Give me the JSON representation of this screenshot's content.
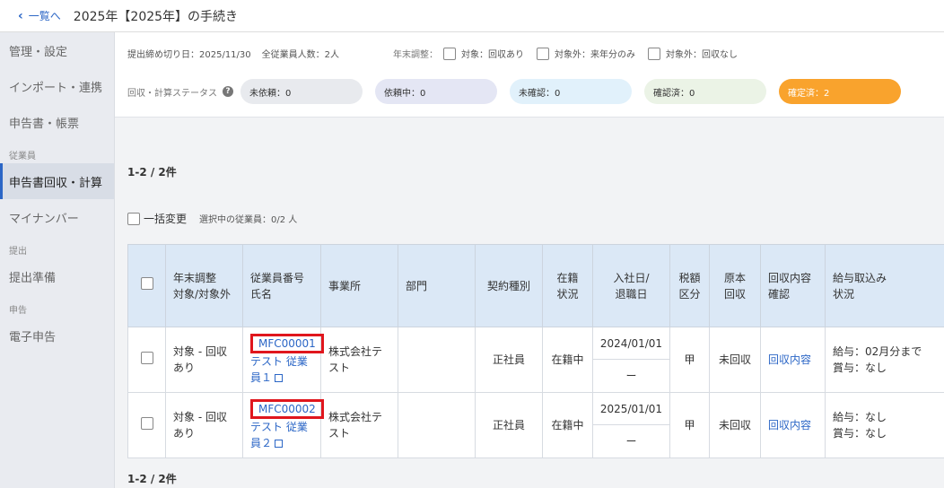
{
  "header": {
    "back_label": "一覧へ",
    "title": "2025年【2025年】の手続き"
  },
  "sidebar": {
    "items": [
      {
        "label": "管理・設定"
      },
      {
        "label": "インポート・連携"
      },
      {
        "label": "申告書・帳票"
      }
    ],
    "section_employee": "従業員",
    "employee_items": [
      {
        "label": "申告書回収・計算"
      },
      {
        "label": "マイナンバー"
      }
    ],
    "section_submit": "提出",
    "submit_items": [
      {
        "label": "提出準備"
      }
    ],
    "section_report": "申告",
    "report_items": [
      {
        "label": "電子申告"
      }
    ]
  },
  "filters": {
    "deadline": "提出締め切り日：2025/11/30",
    "employee_count": "全従業員人数：2人",
    "year_end_label": "年末調整：",
    "options": [
      "対象：回収あり",
      "対象外：来年分のみ",
      "対象外：回収なし"
    ],
    "status_label": "回収・計算ステータス",
    "help": "?",
    "statuses": [
      "未依頼：0",
      "依頼中：0",
      "未確認：0",
      "確認済：0",
      "確定済：2"
    ]
  },
  "list": {
    "count": "1-2 / 2件",
    "bulk_label": "一括変更",
    "selected": "選択中の従業員：0/2 人"
  },
  "table": {
    "headers": [
      "年末調整\n対象/対象外",
      "従業員番号\n氏名",
      "事業所",
      "部門",
      "契約種別",
      "在籍\n状況",
      "入社日/\n退職日",
      "税額\n区分",
      "原本\n回収",
      "回収内容\n確認",
      "給与取込み\n状況"
    ],
    "rows": [
      {
        "target": "対象 - 回収あり",
        "emp_id": "MFC00001",
        "emp_name": "テスト 従業員１",
        "office": "株式会社テスト",
        "dept": "",
        "contract": "正社員",
        "status": "在籍中",
        "join": "2024/01/01",
        "leave": "ー",
        "tax": "甲",
        "original": "未回収",
        "review": "回収内容",
        "payroll": "給与：02月分まで\n賞与：なし"
      },
      {
        "target": "対象 - 回収あり",
        "emp_id": "MFC00002",
        "emp_name": "テスト 従業員２",
        "office": "株式会社テスト",
        "dept": "",
        "contract": "正社員",
        "status": "在籍中",
        "join": "2025/01/01",
        "leave": "ー",
        "tax": "甲",
        "original": "未回収",
        "review": "回収内容",
        "payroll": "給与：なし\n賞与：なし"
      }
    ]
  }
}
